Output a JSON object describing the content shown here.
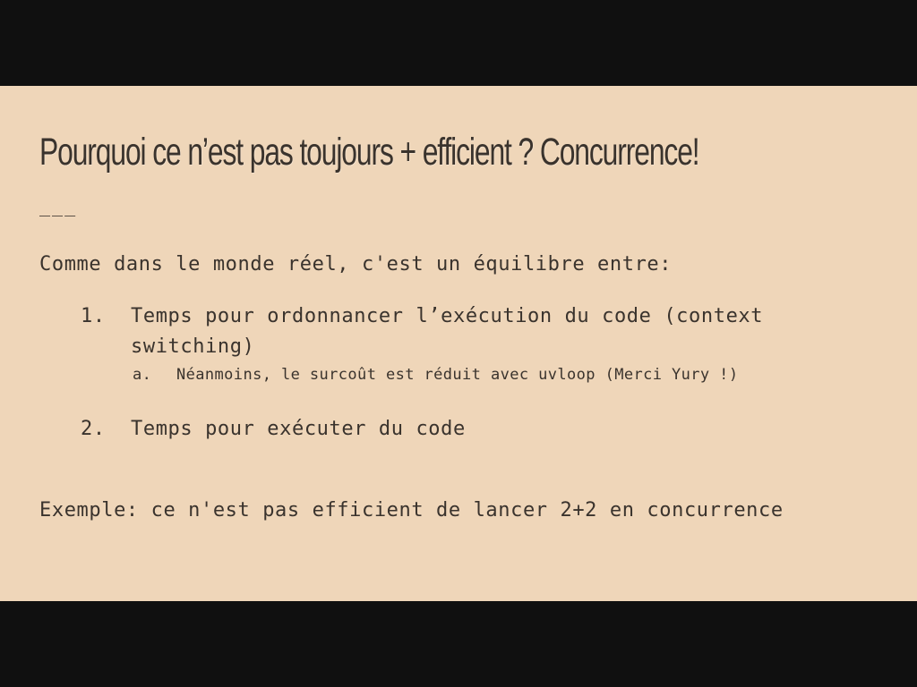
{
  "slide": {
    "title": "Pourquoi ce n’est pas toujours + efficient ? Concurrence!",
    "separator": "___",
    "intro": "Comme dans le monde réel, c'est un équilibre entre:",
    "list": [
      {
        "number": "1.",
        "text_line1": "Temps pour ordonnancer l’exécution du code (context",
        "text_line2": "switching)",
        "sub": {
          "letter": "a.",
          "text": "Néanmoins, le surcoût est réduit avec uvloop (Merci Yury !)"
        }
      },
      {
        "number": "2.",
        "text": "Temps pour exécuter du code"
      }
    ],
    "example": "Exemple: ce n'est pas efficient de lancer 2+2 en concurrence"
  },
  "colors": {
    "slide_background": "#efd6b9",
    "text": "#3a332d",
    "letterbox": "#101010"
  }
}
